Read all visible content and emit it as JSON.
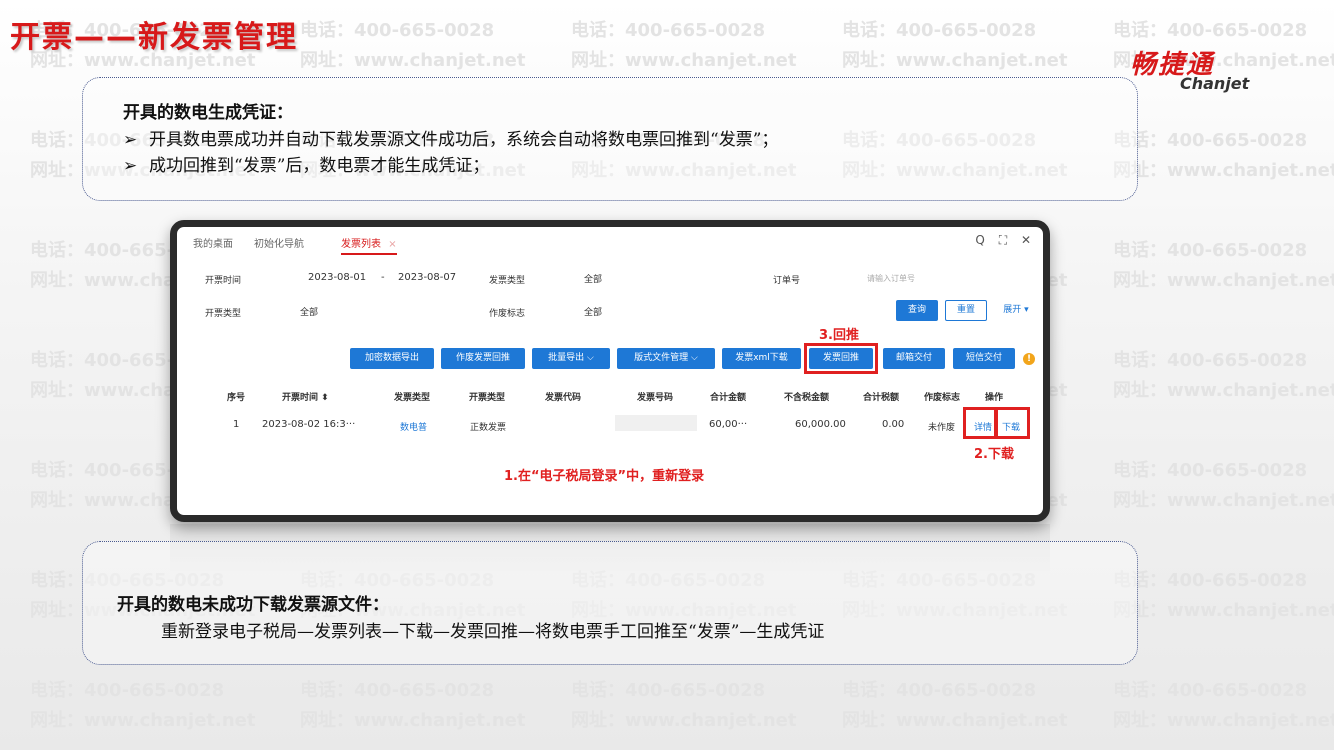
{
  "slide": {
    "title": "开票——新发票管理",
    "logo_cn": "畅捷通",
    "logo_en": "Chanjet",
    "watermark_phone": "电话：400-665-0028",
    "watermark_site": "网址：www.chanjet.net"
  },
  "note1": {
    "heading": "开具的数电生成凭证：",
    "bullet": "➢",
    "lines": [
      "开具数电票成功并自动下载发票源文件成功后，系统会自动将数电票回推到“发票”；",
      "成功回推到“发票”后，数电票才能生成凭证；"
    ]
  },
  "note2": {
    "heading": "开具的数电未成功下载发票源文件：",
    "line": "重新登录电子税局—发票列表—下载—发票回推—将数电票手工回推至“发票”—生成凭证"
  },
  "app": {
    "tabs": [
      "我的桌面",
      "初始化导航",
      "发票列表"
    ],
    "tab_close": "×",
    "window_icons": [
      "Q",
      "⛶",
      "✕"
    ],
    "filters": {
      "date_label": "开票时间",
      "date_from": "2023-08-01",
      "date_sep": "-",
      "date_to": "2023-08-07",
      "invoice_type_label": "发票类型",
      "invoice_type_value": "全部",
      "order_label": "订单号",
      "order_placeholder": "请输入订单号",
      "issue_type_label": "开票类型",
      "issue_type_value": "全部",
      "void_label": "作废标志",
      "void_value": "全部",
      "search_btn": "查询",
      "reset_btn": "重置",
      "expand_btn": "展开 ▾"
    },
    "toolbar": [
      "加密数据导出",
      "作废发票回推",
      "批量导出 ⌵",
      "版式文件管理 ⌵",
      "发票xml下载",
      "发票回推",
      "邮箱交付",
      "短信交付"
    ],
    "warn_icon": "!",
    "columns": [
      "序号",
      "开票时间 ⬍",
      "发票类型",
      "开票类型",
      "发票代码",
      "发票号码",
      "合计金额",
      "不含税金额",
      "合计税额",
      "作废标志",
      "操作"
    ],
    "row": {
      "seq": "1",
      "time": "2023-08-02 16:3···",
      "invoice_type": "数电普",
      "issue_type": "正数发票",
      "code": "",
      "number": "",
      "total": "60,00···",
      "net": "60,000.00",
      "tax": "0.00",
      "void": "未作废",
      "action_detail": "详情",
      "action_download": "下载"
    },
    "annotations": {
      "step1": "1.在“电子税局登录”中，重新登录",
      "step2": "2.下载",
      "step3": "3.回推"
    },
    "colors": {
      "primary": "#1e78d6",
      "annotation_red": "#e02020",
      "title_red": "#d7191a"
    }
  }
}
